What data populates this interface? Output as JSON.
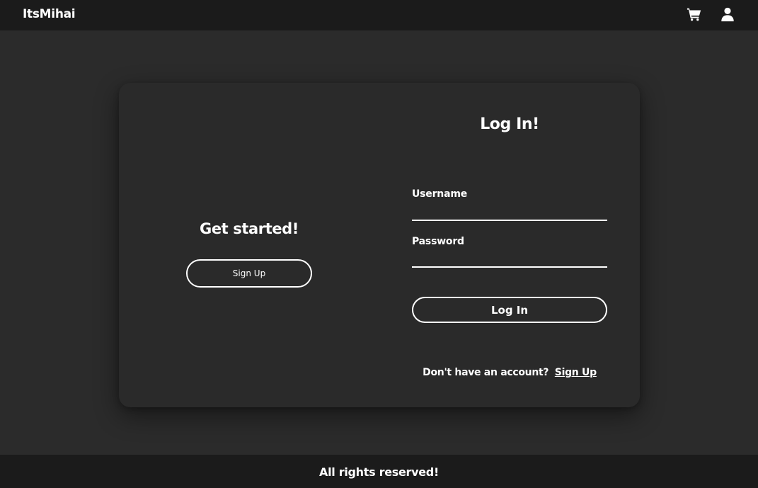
{
  "navbar": {
    "brand": "ItsMihai",
    "icons": [
      "cart-icon",
      "user-icon"
    ]
  },
  "left_panel": {
    "heading": "Get started!",
    "signup_button": "Sign Up"
  },
  "login_form": {
    "title": "Log In!",
    "username_label": "Username",
    "username_value": "",
    "password_label": "Password",
    "password_value": "",
    "submit_button": "Log In",
    "no_account_text": "Don't have an account?",
    "signup_link": "Sign Up"
  },
  "footer": {
    "text": "All rights reserved!"
  },
  "colors": {
    "background": "#2b2b2b",
    "navbar": "#1b1b1b",
    "card": "#2a2a2a",
    "text": "#ffffff"
  }
}
